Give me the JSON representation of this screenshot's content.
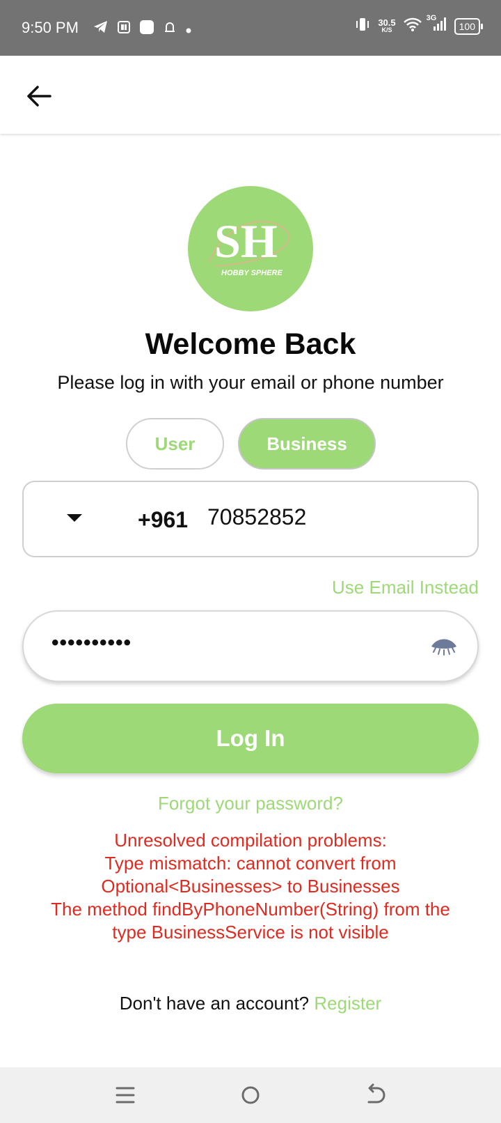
{
  "status_bar": {
    "time": "9:50 PM",
    "net_speed_value": "30.5",
    "net_speed_unit": "K/S",
    "network_type": "3G",
    "battery": "100",
    "icons_left": [
      "telegram-icon",
      "app-notification-icon",
      "square-app-icon",
      "alarm-icon",
      "dot-icon"
    ],
    "icons_right": [
      "vibrate-icon",
      "wifi-icon",
      "signal-icon",
      "battery-icon"
    ]
  },
  "app_bar": {
    "back_icon": "back-arrow-icon"
  },
  "logo": {
    "monogram": "SH",
    "brand_name": "HOBBY SPHERE",
    "bg_color": "#9dd977"
  },
  "header": {
    "title": "Welcome Back",
    "subtitle": "Please log in with your email or phone number"
  },
  "account_type": {
    "options": [
      {
        "label": "User",
        "selected": false
      },
      {
        "label": "Business",
        "selected": true
      }
    ]
  },
  "phone": {
    "country_code": "+961",
    "number": "70852852",
    "dropdown_icon": "caret-down-icon"
  },
  "use_email_link": "Use Email Instead",
  "password": {
    "masked_value": "••••••••••",
    "visibility_icon": "eye-closed-icon"
  },
  "login_button": "Log In",
  "forgot_password": "Forgot your password?",
  "error": {
    "lines": [
      "Unresolved compilation problems:",
      "Type mismatch: cannot convert from",
      "Optional<Businesses> to Businesses",
      "The method findByPhoneNumber(String) from the",
      "type BusinessService is not visible"
    ],
    "color": "#e02a1f"
  },
  "register": {
    "prompt": "Don't have an account?",
    "link": "Register"
  },
  "nav_bar": {
    "buttons": [
      "menu-icon",
      "home-icon",
      "back-icon"
    ]
  },
  "colors": {
    "accent": "#9dd977",
    "status_bar_bg": "#737373"
  }
}
